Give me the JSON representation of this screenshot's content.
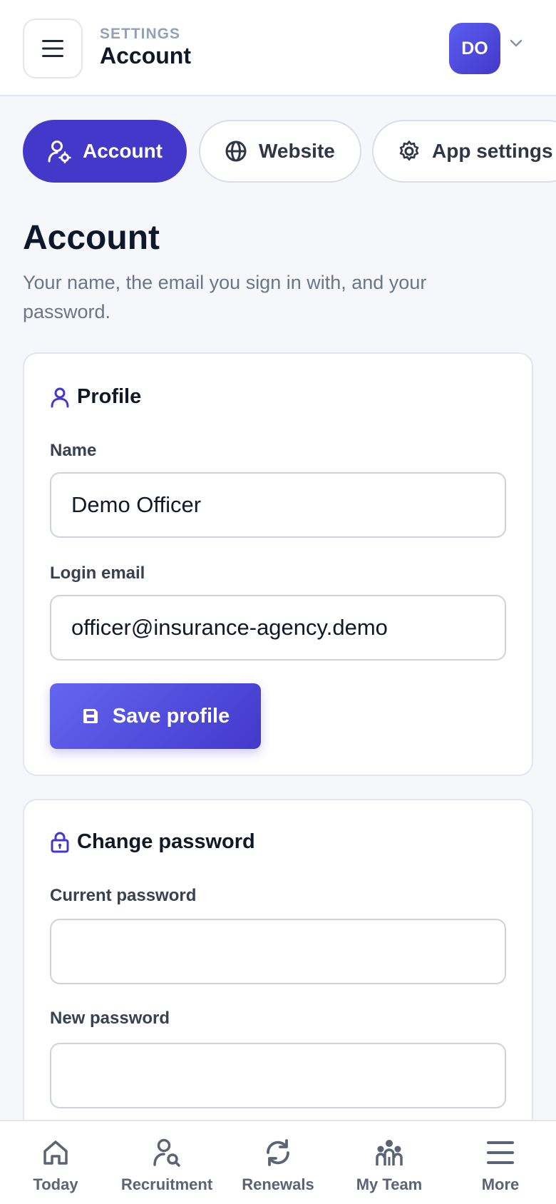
{
  "header": {
    "eyebrow": "SETTINGS",
    "title": "Account",
    "avatar_initials": "DO"
  },
  "tabs": [
    {
      "label": "Account",
      "icon": "user-gear-icon",
      "active": true
    },
    {
      "label": "Website",
      "icon": "globe-icon",
      "active": false
    },
    {
      "label": "App settings",
      "icon": "gear-icon",
      "active": false
    }
  ],
  "page": {
    "title": "Account",
    "description": "Your name, the email you sign in with, and your password."
  },
  "profile": {
    "heading": "Profile",
    "name_label": "Name",
    "name_value": "Demo Officer",
    "email_label": "Login email",
    "email_value": "officer@insurance-agency.demo",
    "save_label": "Save profile"
  },
  "password": {
    "heading": "Change password",
    "current_label": "Current password",
    "current_value": "",
    "new_label": "New password",
    "new_value": ""
  },
  "bottom_nav": [
    {
      "label": "Today",
      "icon": "home-icon"
    },
    {
      "label": "Recruitment",
      "icon": "user-search-icon"
    },
    {
      "label": "Renewals",
      "icon": "refresh-icon"
    },
    {
      "label": "My Team",
      "icon": "team-icon"
    },
    {
      "label": "More",
      "icon": "menu-icon"
    }
  ],
  "colors": {
    "accent": "#4338ca",
    "accent_light": "#6366f1",
    "background": "#f6f7fb",
    "muted_text": "#6b7589"
  }
}
